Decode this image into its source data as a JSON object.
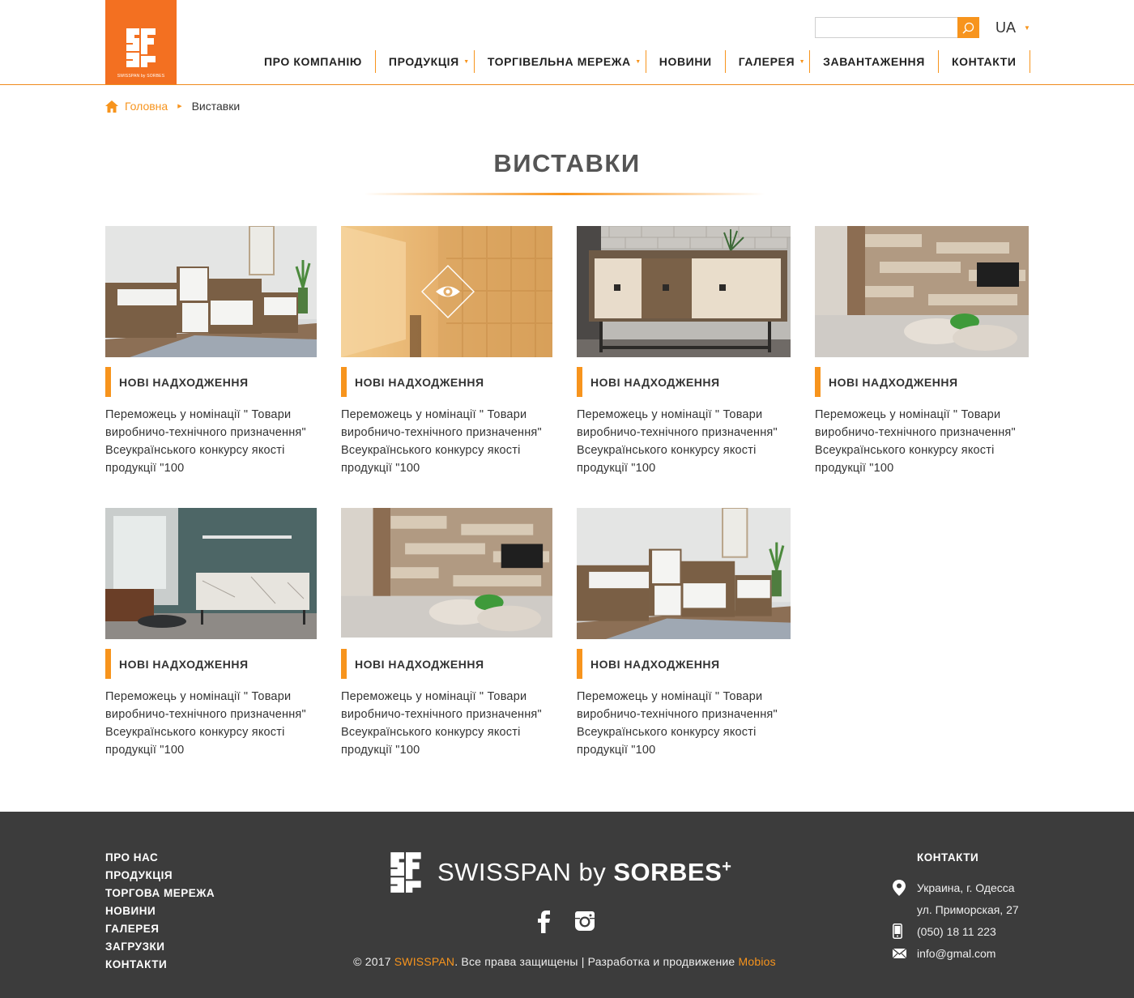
{
  "brand": {
    "logo_caption": "SWISSPAN by SORBES",
    "accent_color": "#f7941d",
    "logo_bg_color": "#f37021"
  },
  "header": {
    "search_placeholder": "",
    "language": "UA",
    "nav": [
      {
        "label": "ПРО КОМПАНІЮ",
        "dropdown": false
      },
      {
        "label": "ПРОДУКЦІЯ",
        "dropdown": true
      },
      {
        "label": "ТОРГІВЕЛЬНА МЕРЕЖА",
        "dropdown": true
      },
      {
        "label": "НОВИНИ",
        "dropdown": false
      },
      {
        "label": "ГАЛЕРЕЯ",
        "dropdown": true
      },
      {
        "label": "ЗАВАНТАЖЕННЯ",
        "dropdown": false
      },
      {
        "label": "КОНТАКТИ",
        "dropdown": false
      }
    ]
  },
  "breadcrumb": {
    "home": "Головна",
    "current": "Виставки"
  },
  "page_title": "ВИСТАВКИ",
  "cards": [
    {
      "category": "НОВІ НАДХОДЖЕННЯ",
      "text": "Переможець у номінації \" Товари виробничо-технічного призначення\" Всеукраїнського конкурсу якості продукції \"100",
      "image": "white-sideboard-room",
      "hovered": false
    },
    {
      "category": "НОВІ НАДХОДЖЕННЯ",
      "text": "Переможець у номінації \" Товари виробничо-технічного призначення\" Всеукраїнського конкурсу якості продукції \"100",
      "image": "shelving-room-blurred",
      "hovered": true
    },
    {
      "category": "НОВІ НАДХОДЖЕННЯ",
      "text": "Переможець у номінації \" Товари виробничо-технічного призначення\" Всеукраїнського конкурсу якості продукції \"100",
      "image": "brick-wall-sideboard",
      "hovered": false
    },
    {
      "category": "НОВІ НАДХОДЖЕННЯ",
      "text": "Переможець у номінації \" Товари виробничо-технічного призначення\" Всеукраїнського конкурсу якості продукції \"100",
      "image": "wood-panel-living-room",
      "hovered": false
    },
    {
      "category": "НОВІ НАДХОДЖЕННЯ",
      "text": "Переможець у номінації \" Товари виробничо-технічного призначення\" Всеукраїнського конкурсу якості продукції \"100",
      "image": "marble-sideboard-teal-room",
      "hovered": false
    },
    {
      "category": "НОВІ НАДХОДЖЕННЯ",
      "text": "Переможець у номінації \" Товари виробничо-технічного призначення\" Всеукраїнського конкурсу якості продукції \"100",
      "image": "wood-panel-living-room",
      "hovered": false
    },
    {
      "category": "НОВІ НАДХОДЖЕННЯ",
      "text": "Переможець у номінації \" Товари виробничо-технічного призначення\" Всеукраїнського конкурсу якості продукції \"100",
      "image": "white-sideboard-room",
      "hovered": false
    }
  ],
  "footer": {
    "nav": [
      "ПРО НАС",
      "ПРОДУКЦІЯ",
      "ТОРГОВА МЕРЕЖА",
      "НОВИНИ",
      "ГАЛЕРЕЯ",
      "ЗАГРУЗКИ",
      "КОНТАКТИ"
    ],
    "brand_name": "SWISSPAN by",
    "brand_bold": "SORBES",
    "brand_plus": "+",
    "social": [
      "facebook-icon",
      "instagram-icon"
    ],
    "copyright_prefix": "© 2017 ",
    "copyright_brand": "SWISSPAN",
    "copyright_middle": ". Все права защищены | Разработка и продвижение ",
    "copyright_dev": "Mobios",
    "contacts_heading": "КОНТАКТИ",
    "address_line1": "Украина, г. Одесса",
    "address_line2": "ул. Приморская, 27",
    "phone": "(050) 18 11 223",
    "email": "info@gmal.com"
  }
}
